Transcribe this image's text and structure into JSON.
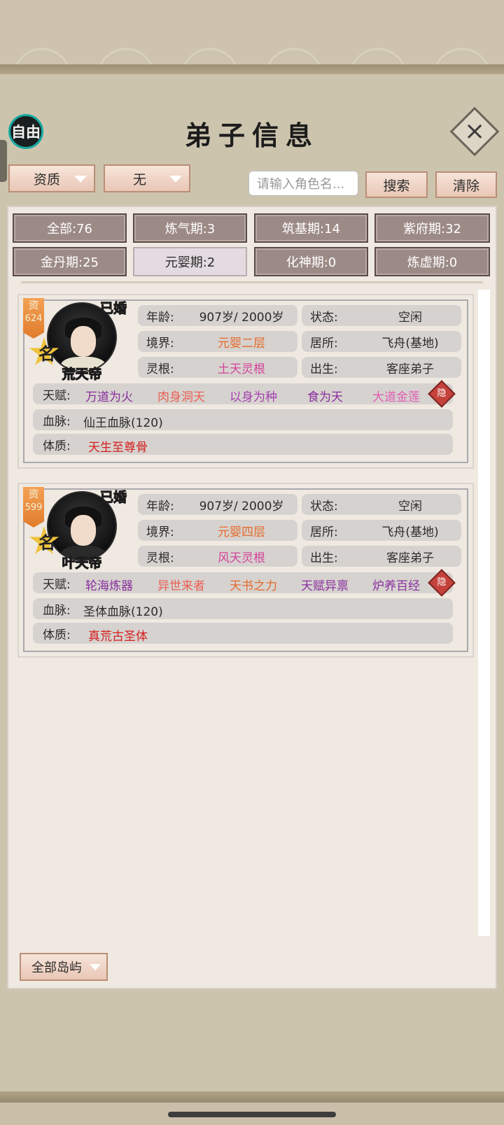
{
  "header": {
    "free_label": "自由",
    "title": "弟子信息",
    "close_glyph": "×"
  },
  "filters": {
    "aptitude_dropdown": "资质",
    "second_dropdown": "无",
    "search_placeholder": "请输入角色名...",
    "search_label": "搜索",
    "clear_label": "清除"
  },
  "realm_tabs": [
    {
      "label": "全部:76"
    },
    {
      "label": "炼气期:3"
    },
    {
      "label": "筑基期:14"
    },
    {
      "label": "紫府期:32"
    },
    {
      "label": "金丹期:25"
    },
    {
      "label": "元婴期:2"
    },
    {
      "label": "化神期:0"
    },
    {
      "label": "炼虚期:0"
    }
  ],
  "disciples": [
    {
      "name": "荒天帝",
      "aptitude_label": "资",
      "aptitude_value": "624",
      "rank_glyph": "名",
      "married": "已婚",
      "age_label": "年龄:",
      "age": "907岁/ 2000岁",
      "status_label": "状态:",
      "status": "空闲",
      "realm_label": "境界:",
      "realm": "元婴二层",
      "residence_label": "居所:",
      "residence": "飞舟(基地)",
      "root_label": "灵根:",
      "root": "土天灵根",
      "birth_label": "出生:",
      "birth": "客座弟子",
      "talent_label": "天赋:",
      "talents": [
        "万道为火",
        "肉身洞天",
        "以身为种",
        "食为天",
        "大道金莲"
      ],
      "hidden_label": "隐",
      "bloodline_label": "血脉:",
      "bloodline": "仙王血脉(120)",
      "physique_label": "体质:",
      "physique": "天生至尊骨"
    },
    {
      "name": "叶天帝",
      "aptitude_label": "资",
      "aptitude_value": "599",
      "rank_glyph": "名",
      "married": "已婚",
      "age_label": "年龄:",
      "age": "907岁/ 2000岁",
      "status_label": "状态:",
      "status": "空闲",
      "realm_label": "境界:",
      "realm": "元婴四层",
      "residence_label": "居所:",
      "residence": "飞舟(基地)",
      "root_label": "灵根:",
      "root": "风天灵根",
      "birth_label": "出生:",
      "birth": "客座弟子",
      "talent_label": "天赋:",
      "talents": [
        "轮海炼器",
        "异世来者",
        "天书之力",
        "天赋异禀",
        "炉养百经"
      ],
      "hidden_label": "隐",
      "bloodline_label": "血脉:",
      "bloodline": "圣体血脉(120)",
      "physique_label": "体质:",
      "physique": "真荒古圣体"
    }
  ],
  "footer": {
    "island_dropdown": "全部岛屿"
  },
  "colors": {
    "accent_teal": "#18a9a1",
    "button_pink": "#e9c7b6",
    "tab_brown": "#9c8a86",
    "text_orange": "#e66a2b",
    "text_pink": "#d4449a",
    "text_purple": "#8a2e9e",
    "text_red": "#d41e1e"
  }
}
